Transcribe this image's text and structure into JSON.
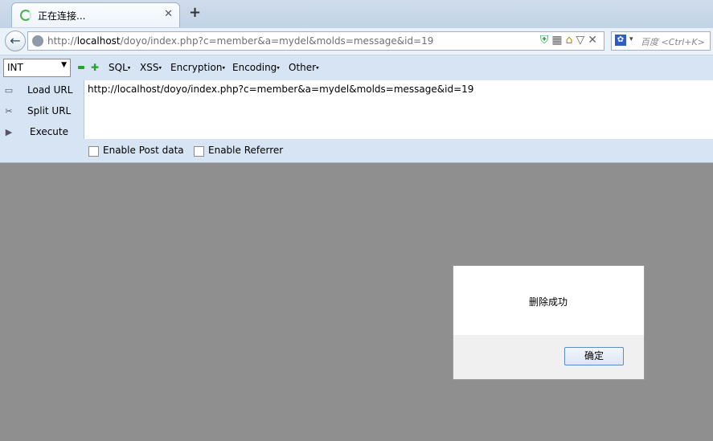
{
  "tab": {
    "title": "正在连接...",
    "close": "✕"
  },
  "newtab": "+",
  "nav": {
    "url_prefix": "http://",
    "url_host": "localhost",
    "url_rest": "/doyo/index.php?c=member&a=mydel&molds=message&id=19",
    "search_placeholder": "百度 <Ctrl+K>"
  },
  "hackbar": {
    "select_value": "INT",
    "menus": [
      "SQL",
      "XSS",
      "Encryption",
      "Encoding",
      "Other"
    ],
    "load_url": "Load URL",
    "split_url": "Split URL",
    "execute": "Execute",
    "url_text": "http://localhost/doyo/index.php?c=member&a=mydel&molds=message&id=19",
    "post_label": "Enable Post data",
    "referrer_label": "Enable Referrer"
  },
  "dialog": {
    "message": "删除成功",
    "ok": "确定"
  }
}
